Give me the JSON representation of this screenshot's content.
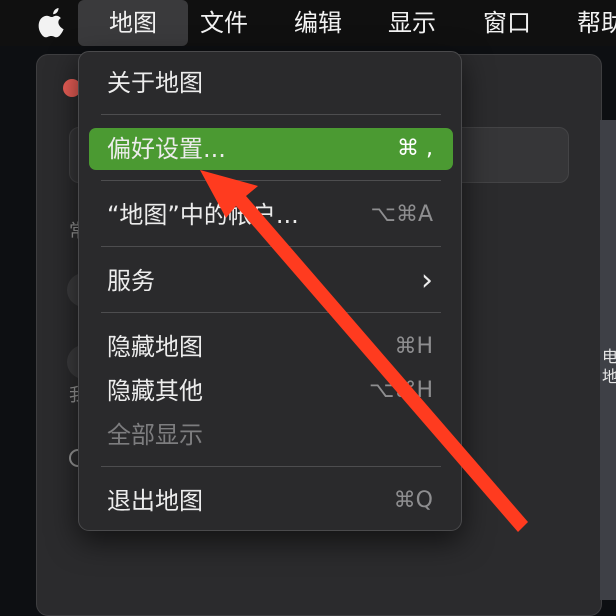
{
  "menubar": {
    "app_menu": "地图",
    "items": [
      "文件",
      "编辑",
      "显示",
      "窗口",
      "帮助"
    ]
  },
  "dropdown": {
    "about": "关于地图",
    "preferences": "偏好设置...",
    "preferences_shortcut": "⌘ ,",
    "account": "“地图”中的帐户...",
    "account_shortcut": "⌥⌘A",
    "services": "服务",
    "services_chevron": "›",
    "hide": "隐藏地图",
    "hide_shortcut": "⌘H",
    "hide_others": "隐藏其他",
    "hide_others_shortcut": "⌥⌘H",
    "show_all": "全部显示",
    "quit": "退出地图",
    "quit_shortcut": "⌘Q"
  },
  "background_window": {
    "label_1": "常",
    "label_2": "我"
  },
  "map_strip": {
    "line_1": "电",
    "line_2": "地"
  },
  "colors": {
    "highlight": "#4b9a32",
    "arrow": "#ff3b1f",
    "close_button": "#ec5f57"
  }
}
